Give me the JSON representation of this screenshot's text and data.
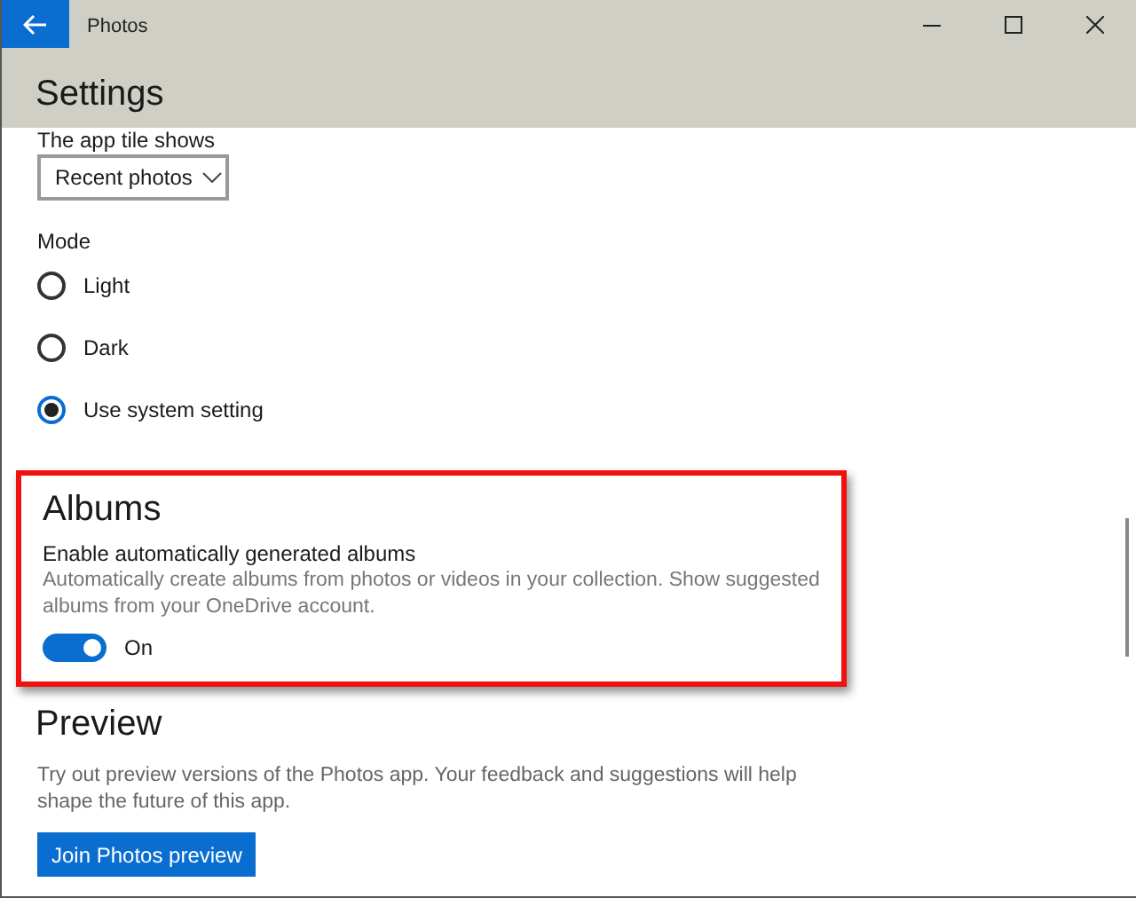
{
  "window": {
    "title": "Photos"
  },
  "page_title": "Settings",
  "app_tile": {
    "label": "The app tile shows",
    "value": "Recent photos"
  },
  "mode": {
    "label": "Mode",
    "options": [
      {
        "label": "Light",
        "selected": false
      },
      {
        "label": "Dark",
        "selected": false
      },
      {
        "label": "Use system setting",
        "selected": true
      }
    ]
  },
  "albums": {
    "heading": "Albums",
    "highlighted": true,
    "setting_label": "Enable automatically generated albums",
    "description": "Automatically create albums from photos or videos in your collection. Show suggested albums from your OneDrive account.",
    "toggle": {
      "on": true,
      "label": "On"
    }
  },
  "preview": {
    "heading": "Preview",
    "description": "Try out preview versions of the Photos app. Your feedback and suggestions will help shape the future of this app.",
    "button": "Join Photos preview"
  }
}
